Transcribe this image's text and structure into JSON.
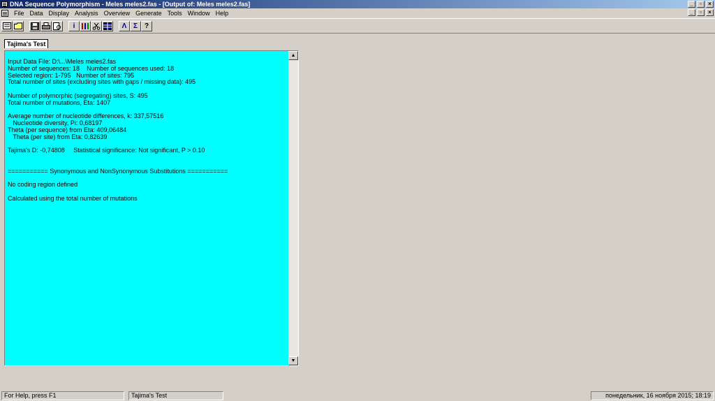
{
  "window": {
    "title": "DNA Sequence Polymorphism - Meles meles2.fas - [Output of: Meles meles2.fas]",
    "minimize_glyph": "_",
    "restore_glyph": "▫",
    "close_glyph": "×"
  },
  "menu": [
    "File",
    "Data",
    "Display",
    "Analysis",
    "Overview",
    "Generate",
    "Tools",
    "Window",
    "Help"
  ],
  "toolbar": {
    "info_glyph": "i",
    "lambda_glyph": "Λ",
    "sigma_glyph": "Σ",
    "help_glyph": "?"
  },
  "tab": {
    "label": "Tajima's Test"
  },
  "output": {
    "lines": [
      "Input Data File: D:\\...\\Meles meles2.fas",
      "Number of sequences: 18    Number of sequences used: 18",
      "Selected region: 1-795   Number of sites: 795",
      "Total number of sites (excluding sites with gaps / missing data): 495",
      "",
      "Number of polymorphic (segregating) sites, S: 495",
      "Total number of mutations, Eta: 1407",
      "",
      "Average number of nucleotide differences, k: 337,57516",
      "   Nucleotide diversity, Pi: 0,68197",
      "Theta (per sequence) from Eta: 409,06484",
      "   Theta (per site) from Eta: 0,82639",
      "",
      "Tajima's D: -0,74808     Statistical significance: Not significant, P > 0.10",
      "",
      "",
      "=========== Synonymous and NonSynonymous Substitutions ===========",
      "",
      "No coding region defined",
      "",
      "Calculated using the total number of mutations"
    ]
  },
  "scrollbar": {
    "up_glyph": "▲",
    "down_glyph": "▼"
  },
  "statusbar": {
    "help": "For Help, press F1",
    "test": "Tajima's Test",
    "datetime": "понедельник, 16 ноября 2015; 18:19"
  }
}
